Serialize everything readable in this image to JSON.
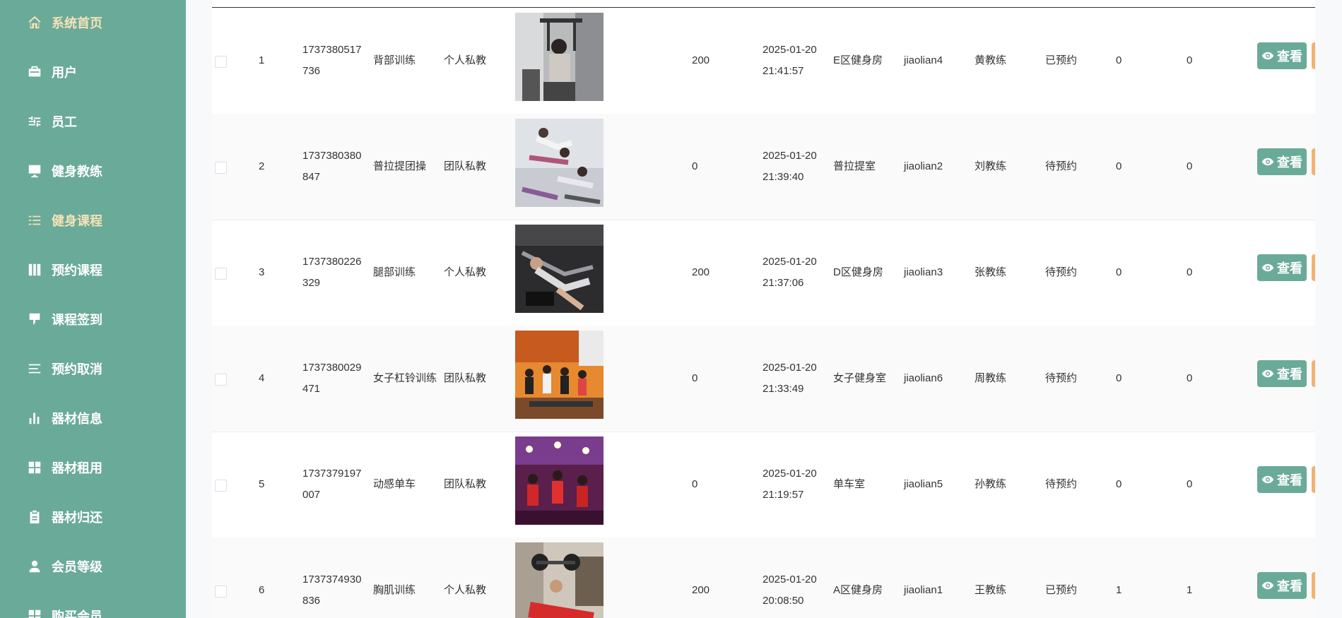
{
  "sidebar": {
    "items": [
      {
        "label": "系统首页",
        "icon": "home-icon",
        "active": true
      },
      {
        "label": "用户",
        "icon": "briefcase-icon"
      },
      {
        "label": "员工",
        "icon": "sliders-icon"
      },
      {
        "label": "健身教练",
        "icon": "monitor-icon"
      },
      {
        "label": "健身课程",
        "icon": "list-icon",
        "active": true
      },
      {
        "label": "预约课程",
        "icon": "book-icon"
      },
      {
        "label": "课程签到",
        "icon": "sign-icon"
      },
      {
        "label": "预约取消",
        "icon": "menu-icon"
      },
      {
        "label": "器材信息",
        "icon": "bar-chart-icon"
      },
      {
        "label": "器材租用",
        "icon": "grid-icon"
      },
      {
        "label": "器材归还",
        "icon": "clipboard-icon"
      },
      {
        "label": "会员等级",
        "icon": "user-icon"
      },
      {
        "label": "购买会员",
        "icon": "grid-icon"
      }
    ]
  },
  "table": {
    "view_button_label": "查看",
    "rows": [
      {
        "index": "1",
        "id_line1": "1737380517",
        "id_line2": "736",
        "name": "背部训练",
        "type": "个人私教",
        "image": "back-training-photo",
        "price": "200",
        "date": "2025-01-20",
        "time": "21:41:57",
        "location": "E区健身房",
        "account": "jiaolian4",
        "coach": "黄教练",
        "status": "已预约",
        "v1": "0",
        "v2": "0"
      },
      {
        "index": "2",
        "id_line1": "1737380380",
        "id_line2": "847",
        "name": "普拉提团操",
        "type": "团队私教",
        "image": "pilates-photo",
        "price": "0",
        "date": "2025-01-20",
        "time": "21:39:40",
        "location": "普拉提室",
        "account": "jiaolian2",
        "coach": "刘教练",
        "status": "待预约",
        "v1": "0",
        "v2": "0"
      },
      {
        "index": "3",
        "id_line1": "1737380226",
        "id_line2": "329",
        "name": "腿部训练",
        "type": "个人私教",
        "image": "leg-training-photo",
        "price": "200",
        "date": "2025-01-20",
        "time": "21:37:06",
        "location": "D区健身房",
        "account": "jiaolian3",
        "coach": "张教练",
        "status": "待预约",
        "v1": "0",
        "v2": "0"
      },
      {
        "index": "4",
        "id_line1": "1737380029",
        "id_line2": "471",
        "name": "女子杠铃训练",
        "type": "团队私教",
        "image": "barbell-class-photo",
        "price": "0",
        "date": "2025-01-20",
        "time": "21:33:49",
        "location": "女子健身室",
        "account": "jiaolian6",
        "coach": "周教练",
        "status": "待预约",
        "v1": "0",
        "v2": "0"
      },
      {
        "index": "5",
        "id_line1": "1737379197",
        "id_line2": "007",
        "name": "动感单车",
        "type": "团队私教",
        "image": "spinning-photo",
        "price": "0",
        "date": "2025-01-20",
        "time": "21:19:57",
        "location": "单车室",
        "account": "jiaolian5",
        "coach": "孙教练",
        "status": "待预约",
        "v1": "0",
        "v2": "0"
      },
      {
        "index": "6",
        "id_line1": "1737374930",
        "id_line2": "836",
        "name": "胸肌训练",
        "type": "个人私教",
        "image": "chest-training-photo",
        "price": "200",
        "date": "2025-01-20",
        "time": "20:08:50",
        "location": "A区健身房",
        "account": "jiaolian1",
        "coach": "王教练",
        "status": "已预约",
        "v1": "1",
        "v2": "1"
      }
    ]
  },
  "colors": {
    "sidebar_bg": "#6aaa98",
    "active_text": "#f6e2b8",
    "view_button": "#6aaa98",
    "edit_button": "#f2b271"
  }
}
